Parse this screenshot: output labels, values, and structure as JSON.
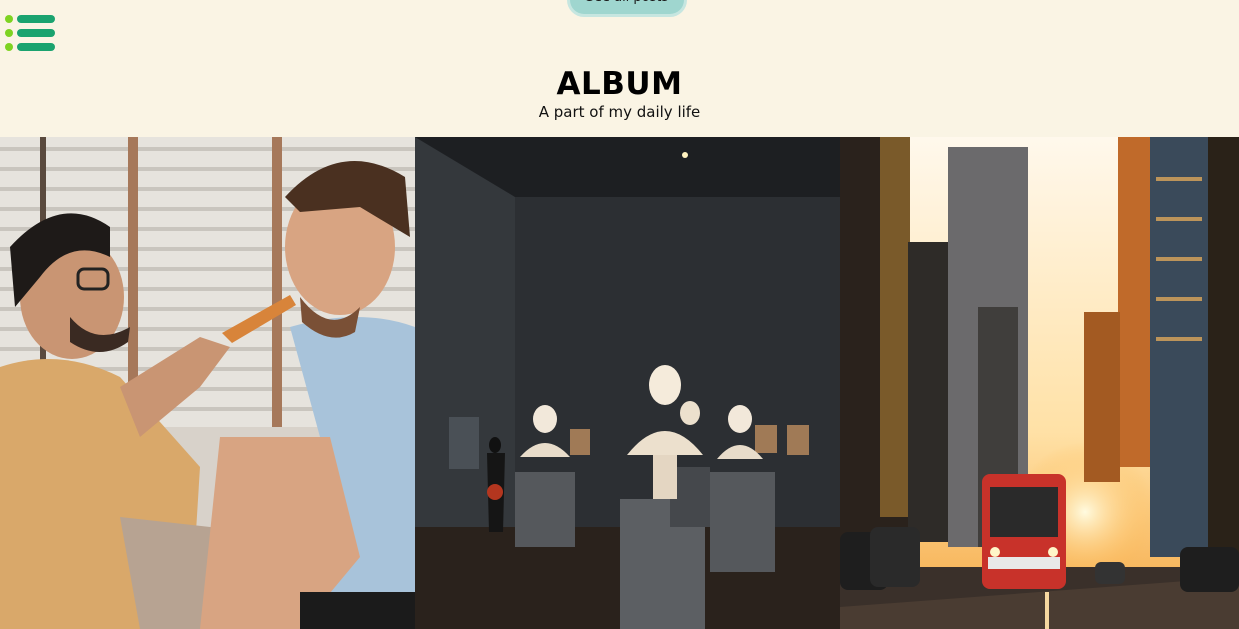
{
  "nav": {
    "see_all_label": "See all posts",
    "menu_icon": "list-menu-icon"
  },
  "header": {
    "title": "ALBUM",
    "subtitle": "A part of my daily life"
  },
  "gallery": {
    "photos": [
      {
        "name": "friends-sharing-pizza-photo"
      },
      {
        "name": "museum-busts-photo"
      },
      {
        "name": "city-street-sunset-tram-photo"
      }
    ]
  },
  "colors": {
    "background": "#faf4e4",
    "pill": "#9fd6cf",
    "icon_green": "#1aa36f",
    "icon_lime": "#7ed321"
  }
}
